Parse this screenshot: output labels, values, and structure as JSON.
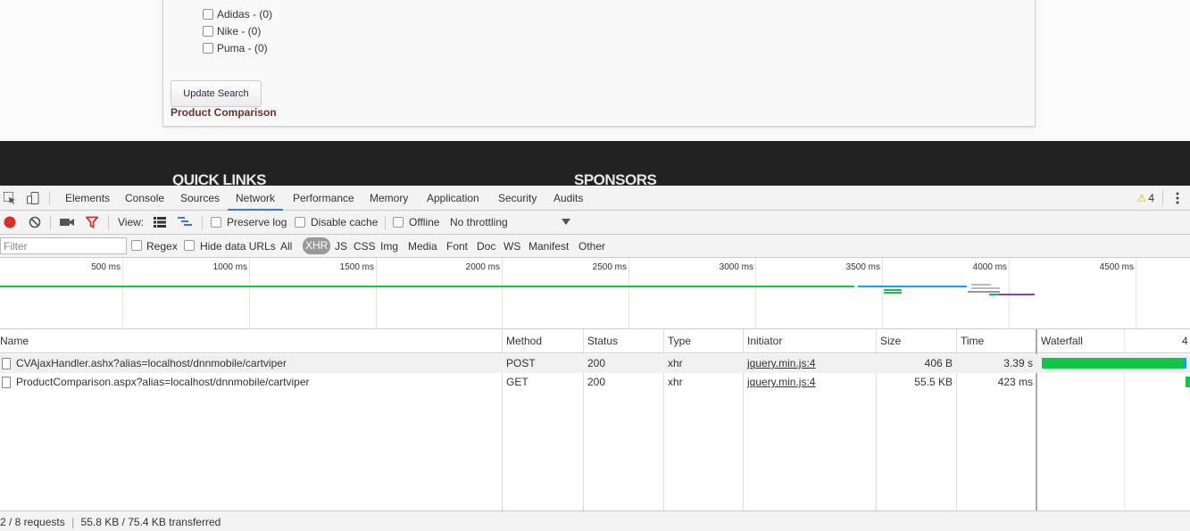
{
  "page": {
    "brands": [
      {
        "label": "Adidas - (0)"
      },
      {
        "label": "Nike - (0)"
      },
      {
        "label": "Puma - (0)"
      }
    ],
    "update_search_label": "Update Search",
    "product_comparison_label": "Product Comparison",
    "footer": {
      "quick_links": "QUICK LINKS",
      "sponsors": "SPONSORS"
    }
  },
  "devtools": {
    "tabs": [
      "Elements",
      "Console",
      "Sources",
      "Network",
      "Performance",
      "Memory",
      "Application",
      "Security",
      "Audits"
    ],
    "active_tab": "Network",
    "warning_count": "4",
    "toolbar": {
      "view_label": "View:",
      "preserve_log": "Preserve log",
      "disable_cache": "Disable cache",
      "offline": "Offline",
      "throttling": "No throttling"
    },
    "filter": {
      "placeholder": "Filter",
      "regex": "Regex",
      "hide_data_urls": "Hide data URLs",
      "types": [
        "All",
        "XHR",
        "JS",
        "CSS",
        "Img",
        "Media",
        "Font",
        "Doc",
        "WS",
        "Manifest",
        "Other"
      ],
      "selected_type": "XHR"
    },
    "overview": {
      "ticks": [
        "500 ms",
        "1000 ms",
        "1500 ms",
        "2000 ms",
        "2500 ms",
        "3000 ms",
        "3500 ms",
        "4000 ms",
        "4500 ms"
      ]
    },
    "columns": [
      "Name",
      "Method",
      "Status",
      "Type",
      "Initiator",
      "Size",
      "Time",
      "Waterfall"
    ],
    "waterfall_tick": "4",
    "requests": [
      {
        "name": "CVAjaxHandler.ashx?alias=localhost/dnnmobile/cartviper",
        "method": "POST",
        "status": "200",
        "type": "xhr",
        "initiator": "jquery.min.js:4",
        "size": "406 B",
        "time": "3.39 s"
      },
      {
        "name": "ProductComparison.aspx?alias=localhost/dnnmobile/cartviper",
        "method": "GET",
        "status": "200",
        "type": "xhr",
        "initiator": "jquery.min.js:4",
        "size": "55.5 KB",
        "time": "423 ms"
      }
    ],
    "status": {
      "requests": "2 / 8 requests",
      "transferred": "55.8 KB / 75.4 KB transferred"
    },
    "colors": {
      "accent": "#3879d9",
      "record": "#d93025",
      "filter_icon": "#d93025",
      "waterfall_green": "#14c447",
      "waterfall_blue": "#1a9ee8"
    }
  }
}
